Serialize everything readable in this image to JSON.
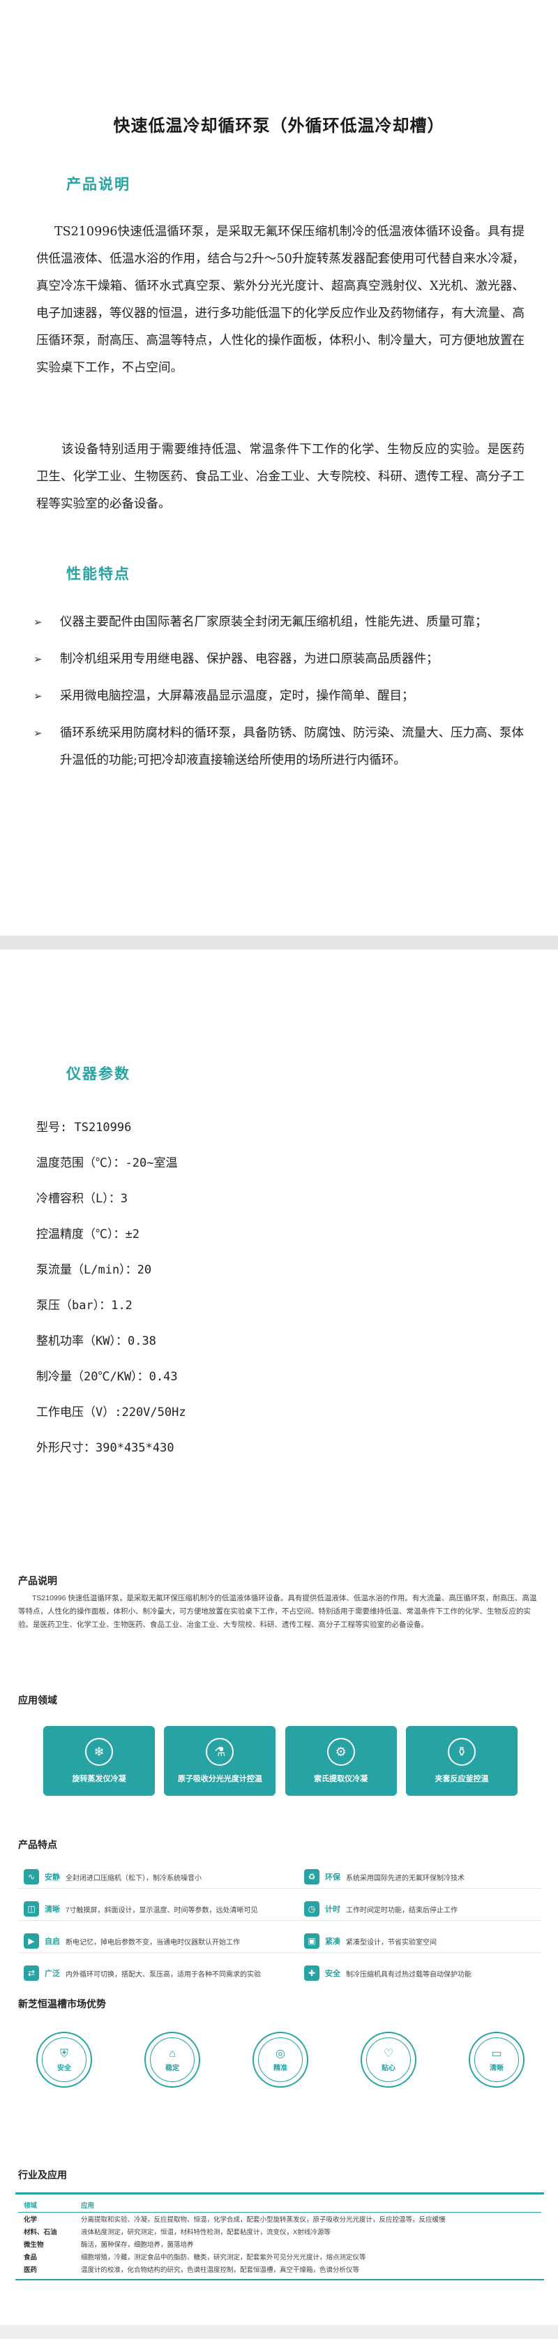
{
  "main_title": "快速低温冷却循环泵（外循环低温冷却槽）",
  "product_desc": {
    "heading": "产品说明",
    "p1": "TS210996快速低温循环泵，是采取无氟环保压缩机制冷的低温液体循环设备。具有提供低温液体、低温水浴的作用，结合与2升～50升旋转蒸发器配套使用可代替自来水冷凝，真空冷冻干燥箱、循环水式真空泵、紫外分光光度计、超高真空溅射仪、X光机、激光器、电子加速器，等仪器的恒温，进行多功能低温下的化学反应作业及药物储存，有大流量、高压循环泵，耐高压、高温等特点，人性化的操作面板，体积小、制冷量大，可方便地放置在实验桌下工作，不占空间。",
    "p2": "该设备特别适用于需要维持低温、常温条件下工作的化学、生物反应的实验。是医药卫生、化学工业、生物医药、食品工业、冶金工业、大专院校、科研、遗传工程、高分子工程等实验室的必备设备。"
  },
  "features": {
    "heading": "性能特点",
    "items": [
      "仪器主要配件由国际著名厂家原装全封闭无氟压缩机组，性能先进、质量可靠；",
      "制冷机组采用专用继电器、保护器、电容器，为进口原装高品质器件；",
      "采用微电脑控温，大屏幕液晶显示温度，定时，操作简单、醒目；",
      "循环系统采用防腐材料的循环泵，具备防锈、防腐蚀、防污染、流量大、压力高、泵体升温低的功能;可把冷却液直接输送给所使用的场所进行内循环。"
    ]
  },
  "params": {
    "heading": "仪器参数",
    "items": [
      "型号: TS210996",
      "温度范围（℃）：-20~室温",
      "冷槽容积（L）：3",
      "控温精度（℃）：±2",
      "泵流量（L/min）：20",
      "泵压（bar）：1.2",
      "整机功率（KW）：0.38",
      "制冷量（20℃/KW）：0.43",
      "工作电压（V）:220V/50Hz",
      "外形尺寸：390*435*430"
    ]
  },
  "info": {
    "desc_heading": "产品说明",
    "desc_text": "TS210996 快速低温循环泵，是采取无氟环保压缩机制冷的低温液体循环设备。具有提供低温液体、低温水浴的作用。有大流量、高压循环泵，耐高压、高温等特点，人性化的操作面板，体积小、制冷量大，可方便地放置在实验桌下工作，不占空间。特别适用于需要维持低温、常温条件下工作的化学、生物反应的实验。是医药卫生、化学工业、生物医药、食品工业、冶金工业、大专院校、科研、遗传工程、高分子工程等实验室的必备设备。",
    "apps_heading": "应用领域",
    "apps": [
      {
        "label": "旋转蒸发仪冷凝",
        "icon": "❄"
      },
      {
        "label": "原子吸收分光光度计控温",
        "icon": "⚗"
      },
      {
        "label": "索氏提取仪冷凝",
        "icon": "⚙"
      },
      {
        "label": "夹套反应釜控温",
        "icon": "⚱"
      }
    ],
    "feat_heading": "产品特点",
    "feats": [
      {
        "key": "安静",
        "val": "全封闭进口压缩机（松下），制冷系统噪音小",
        "icon": "∿"
      },
      {
        "key": "环保",
        "val": "系统采用国际先进的无氟环保制冷技术",
        "icon": "♻"
      },
      {
        "key": "清晰",
        "val": "7寸触摸屏，斜面设计，显示温度、时间等参数，远处清晰可见",
        "icon": "◫"
      },
      {
        "key": "计时",
        "val": "工作时间定时功能，结束后停止工作",
        "icon": "◷"
      },
      {
        "key": "自启",
        "val": "断电记忆，掉电后参数不变，当通电时仪器默认开始工作",
        "icon": "▶"
      },
      {
        "key": "紧凑",
        "val": "紧凑型设计，节省实验室空间",
        "icon": "▣"
      },
      {
        "key": "广泛",
        "val": "内外循环可切换，搭配大、泵压高，适用于各种不同需求的实验",
        "icon": "⇄"
      },
      {
        "key": "安全",
        "val": "制冷压缩机具有过热过载等自动保护功能",
        "icon": "✚"
      }
    ],
    "adv_heading": "新芝恒温槽市场优势",
    "advs": [
      {
        "label": "安全",
        "icon": "⛨"
      },
      {
        "label": "稳定",
        "icon": "⌂"
      },
      {
        "label": "精准",
        "icon": "◎"
      },
      {
        "label": "贴心",
        "icon": "♡"
      },
      {
        "label": "清晰",
        "icon": "▭"
      }
    ],
    "ind_heading": "行业及应用",
    "ind_cols": [
      "领域",
      "应用"
    ],
    "ind_rows": [
      [
        "化学",
        "分离提取和实验、冷凝，反应提取物、恒温，化学合成，配套小型旋转蒸发仪，原子吸收分光光度计，反应控温等，反应缓慢"
      ],
      [
        "材料、石油",
        "液体粘度测定，研究测定，恒温，材料特性检测，配套粘度计，流变仪，X射线冷源等"
      ],
      [
        "微生物",
        "酶活，菌种保存，细胞培养，菌落培养"
      ],
      [
        "食品",
        "细胞增殖，冷藏，测定食品中的脂肪、糖类，研究测定，配套紫外可见分光光度计，熔点测定仪等"
      ],
      [
        "医药",
        "温度计的校准，化合物结构的研究，色谱柱温度控制，配套恒温槽，真空干燥箱，色谱分析仪等"
      ]
    ]
  },
  "colors": {
    "accent": "#27a3a3"
  }
}
